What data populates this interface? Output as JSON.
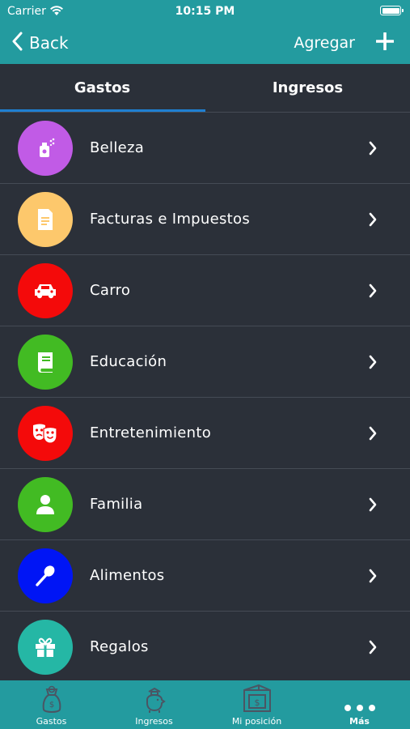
{
  "status_bar": {
    "carrier": "Carrier",
    "time": "10:15 PM"
  },
  "nav": {
    "back_label": "Back",
    "add_label": "Agregar"
  },
  "tabs": [
    {
      "label": "Gastos",
      "active": true
    },
    {
      "label": "Ingresos",
      "active": false
    }
  ],
  "categories": [
    {
      "label": "Belleza",
      "color": "#c15be6",
      "icon": "perfume-icon"
    },
    {
      "label": "Facturas e Impuestos",
      "color": "#fdc86c",
      "icon": "invoice-icon"
    },
    {
      "label": "Carro",
      "color": "#f40a0a",
      "icon": "car-icon"
    },
    {
      "label": "Educación",
      "color": "#42bb23",
      "icon": "book-icon"
    },
    {
      "label": "Entretenimiento",
      "color": "#f40a0a",
      "icon": "theater-masks-icon"
    },
    {
      "label": "Familia",
      "color": "#42bb23",
      "icon": "person-icon"
    },
    {
      "label": "Alimentos",
      "color": "#0015f5",
      "icon": "spoon-icon"
    },
    {
      "label": "Regalos",
      "color": "#25b7a5",
      "icon": "gift-icon"
    }
  ],
  "tabbar": [
    {
      "label": "Gastos",
      "icon": "money-bag-icon",
      "active": false
    },
    {
      "label": "Ingresos",
      "icon": "piggy-bank-icon",
      "active": false
    },
    {
      "label": "Mi posición",
      "icon": "wallet-icon",
      "active": false
    },
    {
      "label": "Más",
      "icon": "more-dots-icon",
      "active": true
    }
  ],
  "colors": {
    "header": "#239b9f",
    "background": "#2b3039",
    "tab_indicator": "#1f7fd1"
  }
}
